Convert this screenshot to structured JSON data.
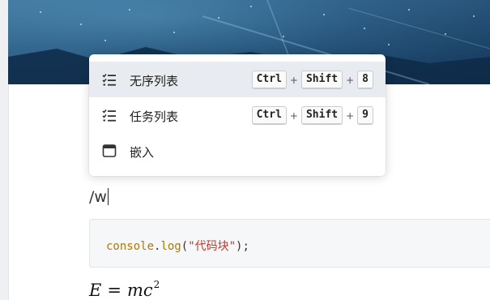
{
  "menu": {
    "items": [
      {
        "label": "无序列表",
        "icon": "unordered-list-icon",
        "keys": [
          "Ctrl",
          "Shift",
          "8"
        ],
        "active": true
      },
      {
        "label": "任务列表",
        "icon": "task-list-icon",
        "keys": [
          "Ctrl",
          "Shift",
          "9"
        ],
        "active": false
      },
      {
        "label": "嵌入",
        "icon": "embed-icon",
        "keys": [],
        "active": false
      }
    ],
    "plus": "+"
  },
  "editor": {
    "typed_text": "/w",
    "code": {
      "ident": "console",
      "dot": ".",
      "fn": "log",
      "open": "(",
      "str": "\"代码块\"",
      "close": ");"
    },
    "math": {
      "lhs": "E",
      "op": "=",
      "m": "m",
      "c": "c",
      "exp": "2"
    }
  },
  "colors": {
    "code_ident": "#b07800",
    "code_string": "#c0392b",
    "menu_active_bg": "#e8ebef"
  }
}
